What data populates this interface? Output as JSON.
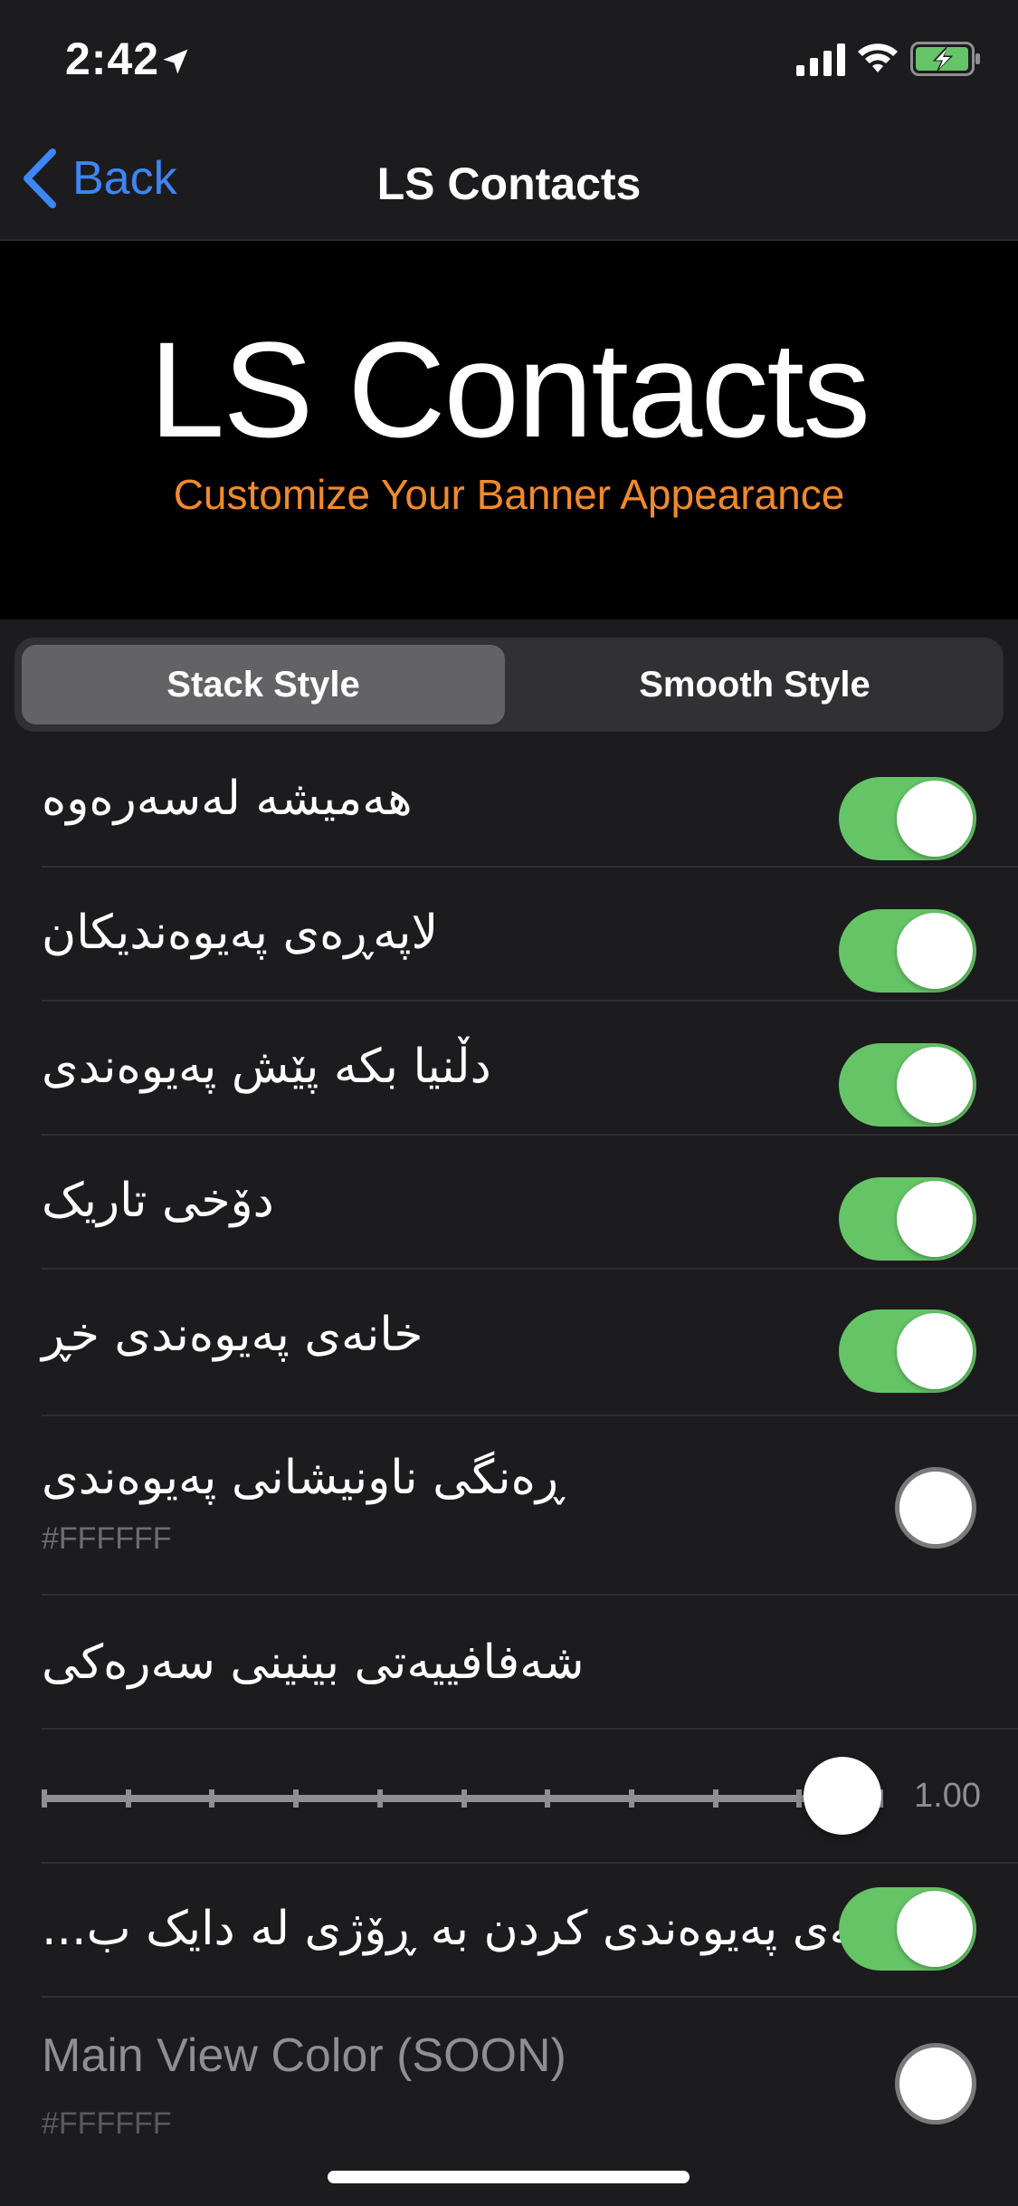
{
  "status_bar": {
    "time": "2:42"
  },
  "nav": {
    "back_label": "Back",
    "title": "LS Contacts"
  },
  "banner": {
    "title": "LS Contacts",
    "subtitle": "Customize Your Banner Appearance"
  },
  "segmented": {
    "options": [
      "Stack Style",
      "Smooth Style"
    ],
    "selected": "Stack Style"
  },
  "settings": [
    {
      "label": "هەمیشە لەسەرەوە",
      "type": "toggle",
      "value": true
    },
    {
      "label": "لاپەڕەی پەیوەندیکان",
      "type": "toggle",
      "value": true
    },
    {
      "label": "دڵنیا بکە پێش پەیوەندی",
      "type": "toggle",
      "value": true
    },
    {
      "label": "دۆخی تاریک",
      "type": "toggle",
      "value": true
    },
    {
      "label": "خانەی پەیوەندی خڕ",
      "type": "toggle",
      "value": true
    },
    {
      "label": "ڕەنگی ناونیشانی پەیوەندی",
      "type": "color",
      "value": "#FFFFFF",
      "sub": "#FFFFFF"
    },
    {
      "label": "شەفافییەتی بینینی سەرەکی",
      "type": "header"
    },
    {
      "type": "slider",
      "value": 1.0,
      "value_text": "1.00",
      "ticks": 11
    },
    {
      "label": "وێنەی پەیوەندی کردن بە ڕۆژی لە دایک ب...",
      "type": "toggle",
      "value": true
    },
    {
      "label": "Main View Color (SOON)",
      "type": "color",
      "value": "#FFFFFF",
      "sub": "#FFFFFF"
    }
  ],
  "colors": {
    "accent": "#3d86f6",
    "toggle_on": "#65c466",
    "subtitle": "#f08a2c"
  }
}
